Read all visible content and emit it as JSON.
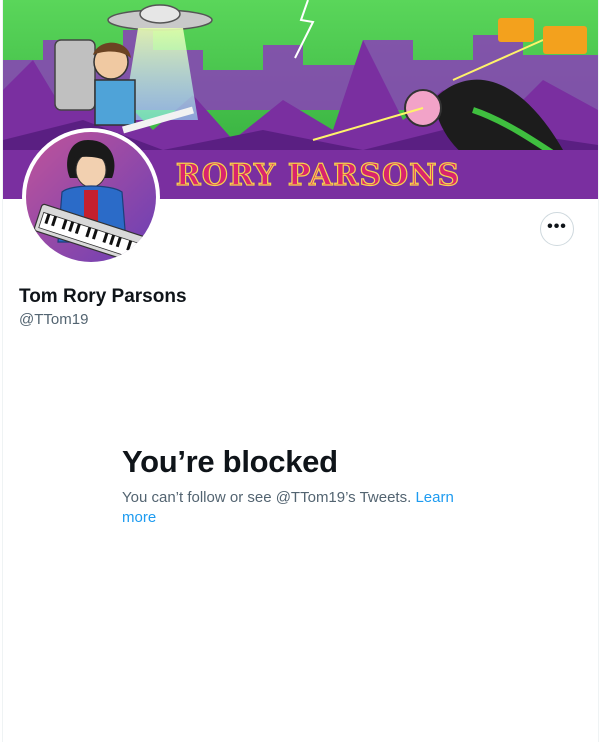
{
  "profile": {
    "banner_text": "RORY PARSONS",
    "display_name": "Tom Rory Parsons",
    "handle": "@TTom19"
  },
  "blocked": {
    "title": "You’re blocked",
    "message": "You can’t follow or see @TTom19’s Tweets.",
    "link_label": "Learn more"
  },
  "actions": {
    "more_icon": "more-horizontal-icon"
  },
  "colors": {
    "link": "#1d9bf0",
    "secondary_text": "#536471",
    "banner_purple": "#7a2fa0",
    "banner_green": "#4fd04a",
    "banner_title_fill": "#d8246e"
  }
}
